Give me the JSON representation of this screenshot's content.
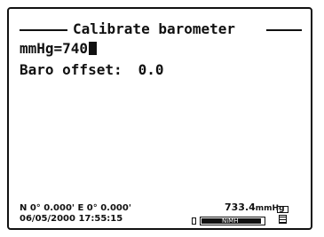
{
  "title": "Calibrate barometer",
  "fields": {
    "mmhg": "mmHg=740",
    "baro_offset_label": "Baro offset:",
    "baro_offset_value": "0.0"
  },
  "status": {
    "gps": "N 0° 0.000' E 0° 0.000'",
    "datetime": "06/05/2000 17:55:15",
    "pressure_value": "733.4",
    "pressure_unit": "mmHg",
    "battery_label": "NiMH",
    "battery_level_percent": 95
  },
  "icons": {
    "battery": "battery-icon",
    "device": "device-icon"
  }
}
